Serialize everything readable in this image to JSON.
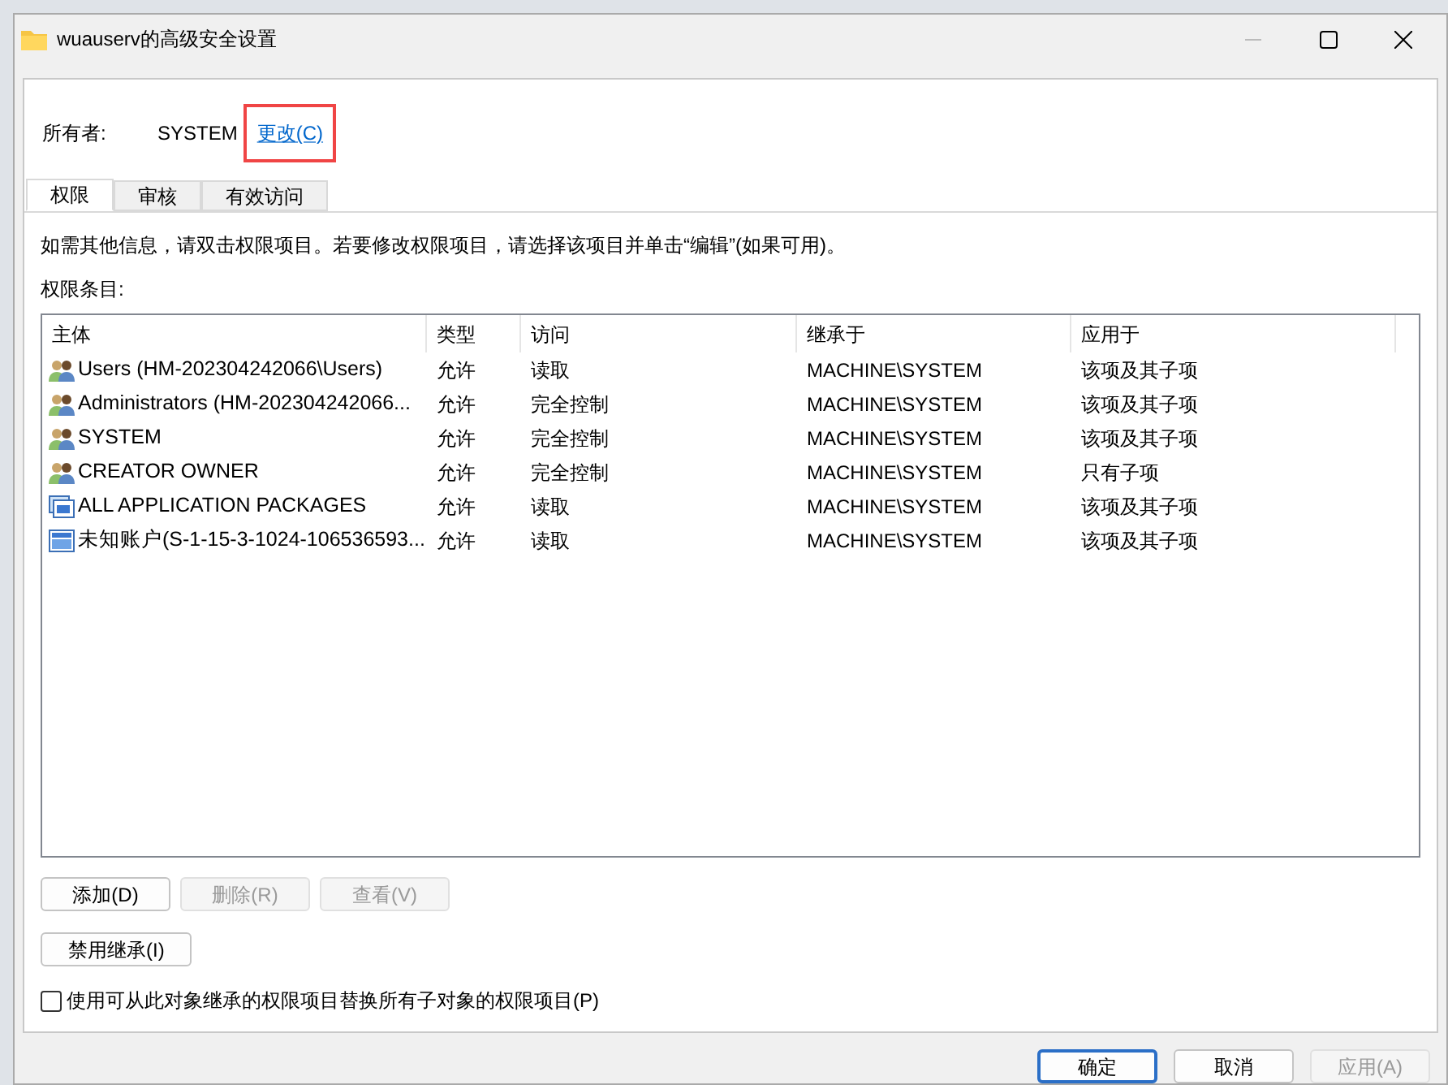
{
  "window": {
    "title": "wuauserv的高级安全设置"
  },
  "owner": {
    "label": "所有者:",
    "value": "SYSTEM",
    "change_link": "更改(C)",
    "highlighted": true
  },
  "tabs": [
    {
      "label": "权限",
      "selected": true
    },
    {
      "label": "审核",
      "selected": false
    },
    {
      "label": "有效访问",
      "selected": false
    }
  ],
  "info": "如需其他信息，请双击权限项目。若要修改权限项目，请选择该项目并单击“编辑”(如果可用)。",
  "entries_label": "权限条目:",
  "table": {
    "columns": [
      "主体",
      "类型",
      "访问",
      "继承于",
      "应用于"
    ],
    "rows": [
      {
        "kind": "group",
        "cells": [
          "Users (HM-202304242066\\Users)",
          "允许",
          "读取",
          "MACHINE\\SYSTEM",
          "该项及其子项"
        ]
      },
      {
        "kind": "group",
        "cells": [
          "Administrators (HM-202304242066...",
          "允许",
          "完全控制",
          "MACHINE\\SYSTEM",
          "该项及其子项"
        ]
      },
      {
        "kind": "group",
        "cells": [
          "SYSTEM",
          "允许",
          "完全控制",
          "MACHINE\\SYSTEM",
          "该项及其子项"
        ]
      },
      {
        "kind": "group",
        "cells": [
          "CREATOR OWNER",
          "允许",
          "完全控制",
          "MACHINE\\SYSTEM",
          "只有子项"
        ]
      },
      {
        "kind": "package",
        "cells": [
          "ALL APPLICATION PACKAGES",
          "允许",
          "读取",
          "MACHINE\\SYSTEM",
          "该项及其子项"
        ]
      },
      {
        "kind": "app",
        "cells": [
          "未知账户(S-1-15-3-1024-106536593...",
          "允许",
          "读取",
          "MACHINE\\SYSTEM",
          "该项及其子项"
        ]
      }
    ]
  },
  "actions": [
    {
      "label": "添加(D)",
      "disabled": false
    },
    {
      "label": "删除(R)",
      "disabled": true
    },
    {
      "label": "查看(V)",
      "disabled": true
    }
  ],
  "inherit_button": {
    "label": "禁用继承(I)",
    "disabled": false
  },
  "replace_checkbox": {
    "label": "使用可从此对象继承的权限项目替换所有子对象的权限项目(P)",
    "checked": false
  },
  "footer": [
    {
      "label": "确定",
      "disabled": false,
      "default": true
    },
    {
      "label": "取消",
      "disabled": false,
      "default": false
    },
    {
      "label": "应用(A)",
      "disabled": true,
      "default": false
    }
  ]
}
